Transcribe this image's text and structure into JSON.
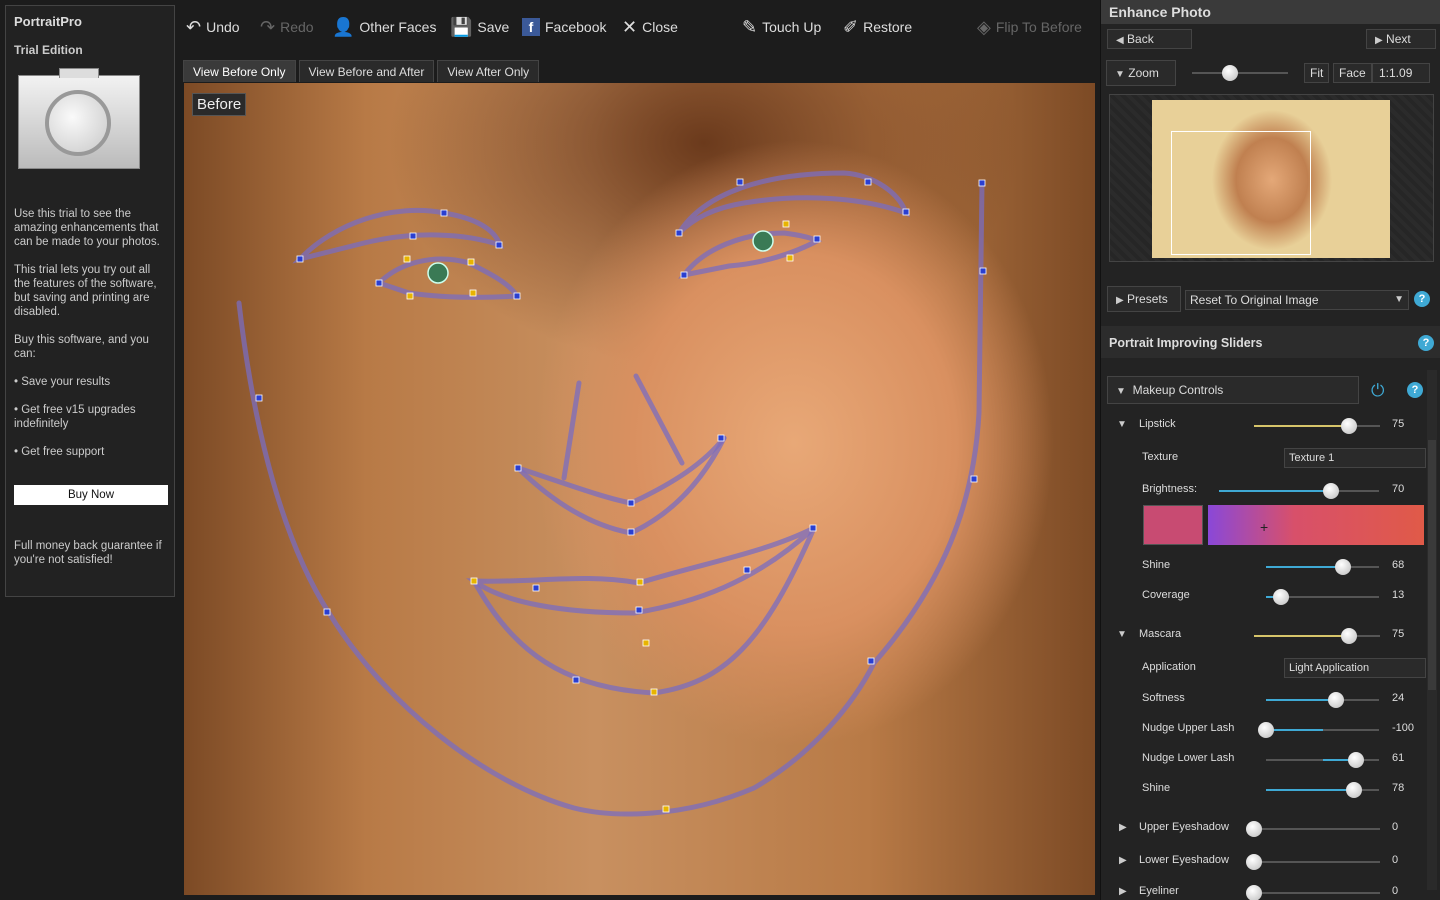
{
  "left": {
    "brand": "PortraitPro",
    "edition": "Trial Edition",
    "p1": "Use this trial to see the amazing enhancements that can be made to your photos.",
    "p2": "This trial lets you try out all the features of the software, but saving and printing are disabled.",
    "p3": "Buy this software, and you can:",
    "b1": "• Save your results",
    "b2": "• Get free v15 upgrades indefinitely",
    "b3": "• Get free support",
    "buy": "Buy Now",
    "guarantee": "Full money back guarantee if you're not satisfied!"
  },
  "toolbar": {
    "undo": "Undo",
    "redo": "Redo",
    "other_faces": "Other Faces",
    "save": "Save",
    "facebook": "Facebook",
    "close": "Close",
    "touch_up": "Touch Up",
    "restore": "Restore",
    "flip": "Flip To Before"
  },
  "tabs": [
    "View Before Only",
    "View Before and After",
    "View After Only"
  ],
  "photo": {
    "overlay_label": "Before"
  },
  "panel": {
    "title": "Enhance Photo",
    "back": "Back",
    "next": "Next",
    "zoom": "Zoom",
    "fit": "Fit",
    "face": "Face",
    "zoom_value": "1:1.09",
    "zoom_level": 0.4,
    "presets": "Presets",
    "preset_value": "Reset To Original Image",
    "sliders_title": "Portrait Improving Sliders",
    "makeup": "Makeup Controls",
    "lipstick": {
      "label": "Lipstick",
      "value": "75"
    },
    "texture": {
      "label": "Texture",
      "value": "Texture 1"
    },
    "brightness": {
      "label": "Brightness:",
      "value": "70"
    },
    "shine": {
      "label": "Shine",
      "value": "68"
    },
    "coverage": {
      "label": "Coverage",
      "value": "13"
    },
    "mascara": {
      "label": "Mascara",
      "value": "75"
    },
    "application": {
      "label": "Application",
      "value": "Light Application"
    },
    "softness": {
      "label": "Softness",
      "value": "24"
    },
    "upper_lash": {
      "label": "Nudge Upper Lash",
      "value": "-100"
    },
    "lower_lash": {
      "label": "Nudge Lower Lash",
      "value": "61"
    },
    "mshine": {
      "label": "Shine",
      "value": "78"
    },
    "upper_eyeshadow": {
      "label": "Upper Eyeshadow",
      "value": "0"
    },
    "lower_eyeshadow": {
      "label": "Lower Eyeshadow",
      "value": "0"
    },
    "eyeliner": {
      "label": "Eyeliner",
      "value": "0"
    }
  },
  "colors": {
    "lip_swatch": "#c84b72",
    "accent_blue": "#3fa9d4",
    "accent_yellow": "#d6c46a"
  }
}
